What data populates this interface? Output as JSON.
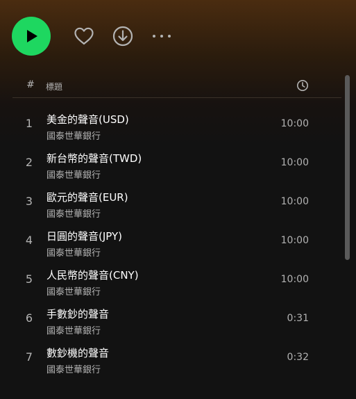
{
  "action_bar": {
    "play_icon": "play-icon",
    "heart_icon": "heart-icon",
    "download_icon": "download-icon",
    "more_icon": "more-icon",
    "accent_color": "#1ed760"
  },
  "list_header": {
    "number_label": "#",
    "title_label": "標題",
    "duration_icon": "clock-icon"
  },
  "tracks": [
    {
      "number": "1",
      "title": "美金的聲音(USD)",
      "artist": "國泰世華銀行",
      "duration": "10:00"
    },
    {
      "number": "2",
      "title": "新台幣的聲音(TWD)",
      "artist": "國泰世華銀行",
      "duration": "10:00"
    },
    {
      "number": "3",
      "title": "歐元的聲音(EUR)",
      "artist": "國泰世華銀行",
      "duration": "10:00"
    },
    {
      "number": "4",
      "title": "日圓的聲音(JPY)",
      "artist": "國泰世華銀行",
      "duration": "10:00"
    },
    {
      "number": "5",
      "title": "人民幣的聲音(CNY)",
      "artist": "國泰世華銀行",
      "duration": "10:00"
    },
    {
      "number": "6",
      "title": "手數鈔的聲音",
      "artist": "國泰世華銀行",
      "duration": "0:31"
    },
    {
      "number": "7",
      "title": "數鈔機的聲音",
      "artist": "國泰世華銀行",
      "duration": "0:32"
    }
  ]
}
